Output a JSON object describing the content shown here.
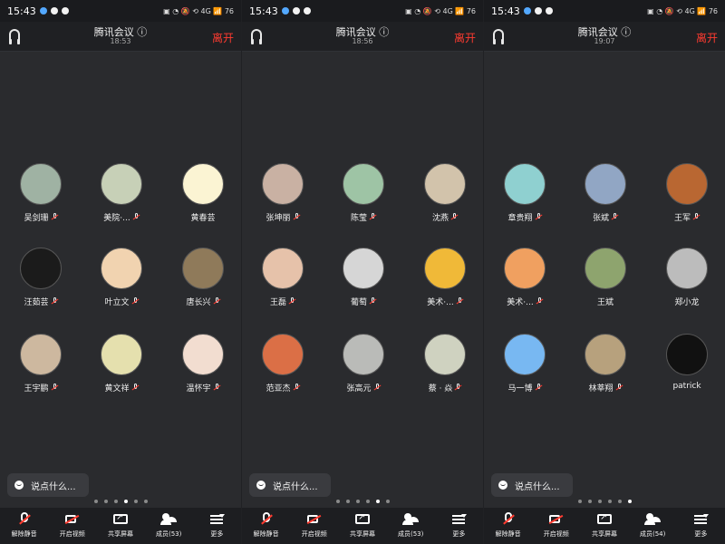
{
  "panels": [
    {
      "status_time": "15:43",
      "status_right": "▣ ◔ 🔕 ⟲ 4G 📶 76",
      "title": "腾讯会议 ⓘ",
      "meeting_time": "18:53",
      "leave_label": "离开",
      "chat_placeholder": "说点什么...",
      "page_dots_active": 3,
      "participants": [
        {
          "name": "吴剑珊",
          "avatar_color": "#9fb2a3"
        },
        {
          "name": "美院·...",
          "avatar_color": "#c7d0b7"
        },
        {
          "name": "黄春芸",
          "avatar_color": "#fbf4d3"
        },
        {
          "name": "汪茹芸",
          "avatar_color": "#1b1b1b"
        },
        {
          "name": "叶立文",
          "avatar_color": "#f1d3b0"
        },
        {
          "name": "唐长兴",
          "avatar_color": "#8f7a5a"
        },
        {
          "name": "王宇鹏",
          "avatar_color": "#cdb89f"
        },
        {
          "name": "黄文祥",
          "avatar_color": "#e5e0ae"
        },
        {
          "name": "温怀宇",
          "avatar_color": "#f2ddd0"
        }
      ],
      "toolbar": {
        "mute_label": "解除静音",
        "video_label": "开启视频",
        "share_label": "共享屏幕",
        "members_label": "成员(53)",
        "more_label": "更多"
      }
    },
    {
      "status_time": "15:43",
      "status_right": "▣ ◔ 🔕 ⟲ 4G 📶 76",
      "title": "腾讯会议 ⓘ",
      "meeting_time": "18:56",
      "leave_label": "离开",
      "chat_placeholder": "说点什么...",
      "page_dots_active": 4,
      "participants": [
        {
          "name": "张坤丽",
          "avatar_color": "#c9b1a3"
        },
        {
          "name": "陈莹",
          "avatar_color": "#9ec4a5"
        },
        {
          "name": "沈燕",
          "avatar_color": "#d2c3ab"
        },
        {
          "name": "王磊",
          "avatar_color": "#e6c2aa"
        },
        {
          "name": "葡萄",
          "avatar_color": "#d6d6d6"
        },
        {
          "name": "美术·...",
          "avatar_color": "#f0b938"
        },
        {
          "name": "范亚杰",
          "avatar_color": "#db6f46"
        },
        {
          "name": "张高元",
          "avatar_color": "#babbb8"
        },
        {
          "name": "蔡 · 焱",
          "avatar_color": "#cfd2c0"
        }
      ],
      "toolbar": {
        "mute_label": "解除静音",
        "video_label": "开启视频",
        "share_label": "共享屏幕",
        "members_label": "成员(53)",
        "more_label": "更多"
      }
    },
    {
      "status_time": "15:43",
      "status_right": "▣ ◔ 🔕 ⟲ 4G 📶 76",
      "title": "腾讯会议 ⓘ",
      "meeting_time": "19:07",
      "leave_label": "离开",
      "chat_placeholder": "说点什么...",
      "page_dots_active": 5,
      "participants": [
        {
          "name": "章贵翔",
          "avatar_color": "#8fd0d0"
        },
        {
          "name": "张斌",
          "avatar_color": "#91a6c4"
        },
        {
          "name": "王军",
          "avatar_color": "#b96732"
        },
        {
          "name": "美术·...",
          "avatar_color": "#f0a060"
        },
        {
          "name": "王斌",
          "avatar_color": "#8ea46e"
        },
        {
          "name": "郑小龙",
          "avatar_color": "#bcbcbc"
        },
        {
          "name": "马一博",
          "avatar_color": "#78b8f2"
        },
        {
          "name": "林莘翔",
          "avatar_color": "#b7a17d"
        },
        {
          "name": "patrick",
          "avatar_color": "#111111"
        }
      ],
      "toolbar": {
        "mute_label": "解除静音",
        "video_label": "开启视频",
        "share_label": "共享屏幕",
        "members_label": "成员(54)",
        "more_label": "更多"
      }
    }
  ]
}
